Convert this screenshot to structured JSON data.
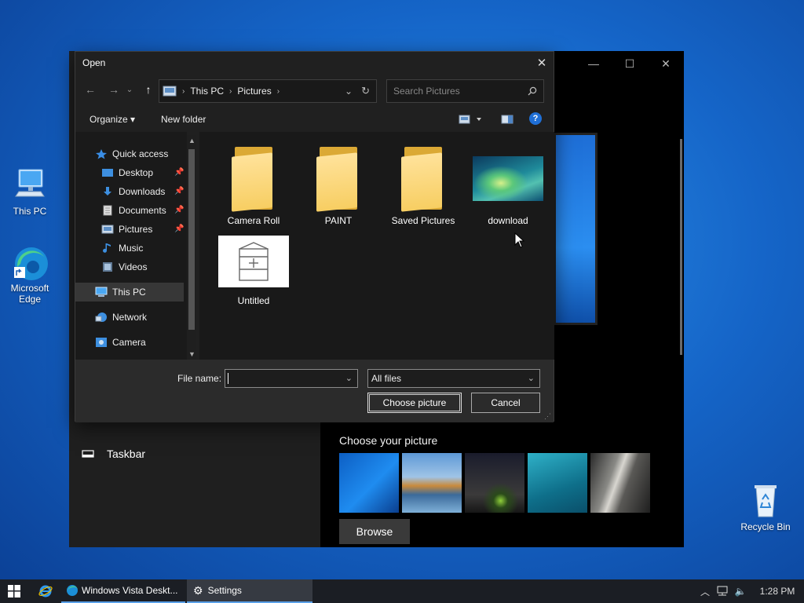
{
  "desktop": {
    "icons": [
      {
        "label": "This PC"
      },
      {
        "label": "Microsoft Edge"
      },
      {
        "label": "Recycle Bin"
      }
    ]
  },
  "settings": {
    "taskbar_label": "Taskbar",
    "choose_picture_label": "Choose your picture",
    "browse_label": "Browse",
    "window_buttons": {
      "minimize": "—",
      "maximize": "☐",
      "close": "✕"
    }
  },
  "dialog": {
    "title": "Open",
    "close_glyph": "✕",
    "breadcrumb": [
      "This PC",
      "Pictures"
    ],
    "search_placeholder": "Search Pictures",
    "toolbar": {
      "organize": "Organize ▾",
      "new_folder": "New folder",
      "help": "?"
    },
    "nav": [
      {
        "label": "Quick access"
      },
      {
        "label": "Desktop"
      },
      {
        "label": "Downloads"
      },
      {
        "label": "Documents"
      },
      {
        "label": "Pictures"
      },
      {
        "label": "Music"
      },
      {
        "label": "Videos"
      },
      {
        "label": "This PC"
      },
      {
        "label": "Network"
      },
      {
        "label": "Camera"
      }
    ],
    "items": [
      {
        "label": "Camera Roll",
        "kind": "folder"
      },
      {
        "label": "PAINT",
        "kind": "folder"
      },
      {
        "label": "Saved Pictures",
        "kind": "folder"
      },
      {
        "label": "download",
        "kind": "image"
      },
      {
        "label": "Untitled",
        "kind": "image"
      }
    ],
    "file_name_label": "File name:",
    "file_name_value": "",
    "filter_value": "All files",
    "choose_button": "Choose picture",
    "cancel_button": "Cancel"
  },
  "taskbar": {
    "apps": [
      {
        "label": "Windows Vista Deskt..."
      },
      {
        "label": "Settings"
      }
    ],
    "clock": "1:28 PM"
  },
  "colors": {
    "accent": "#0078d7",
    "folder": "#f7ce62",
    "dialog_bg": "#202020"
  }
}
